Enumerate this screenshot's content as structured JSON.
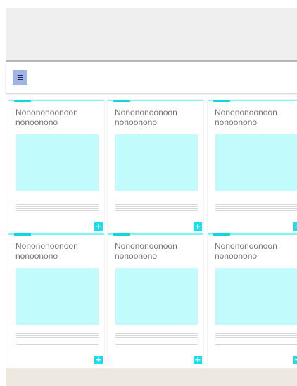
{
  "toolbar": {
    "menu_icon": "hamburger-menu-icon"
  },
  "cards": [
    {
      "title": "Nonononoonoon nonoonono",
      "add_label": "+"
    },
    {
      "title": "Nonononoonoon nonoonono",
      "add_label": "+"
    },
    {
      "title": "Nonononoonoon nonoonono",
      "add_label": "+"
    },
    {
      "title": "Nonononoonoon nonoonono",
      "add_label": "+"
    },
    {
      "title": "Nonononoonoon nonoonono",
      "add_label": "+"
    },
    {
      "title": "Nonononoonoon nonoonono",
      "add_label": "+"
    }
  ],
  "colors": {
    "accent": "#10d8d8",
    "card_top_border": "#7ff6f6",
    "thumbnail": "#c2fbfb",
    "add_button": "#16e0f0",
    "menu_button": "#9fb3e6",
    "header_bg": "#efefef",
    "footer_bg": "#ede9e0"
  }
}
